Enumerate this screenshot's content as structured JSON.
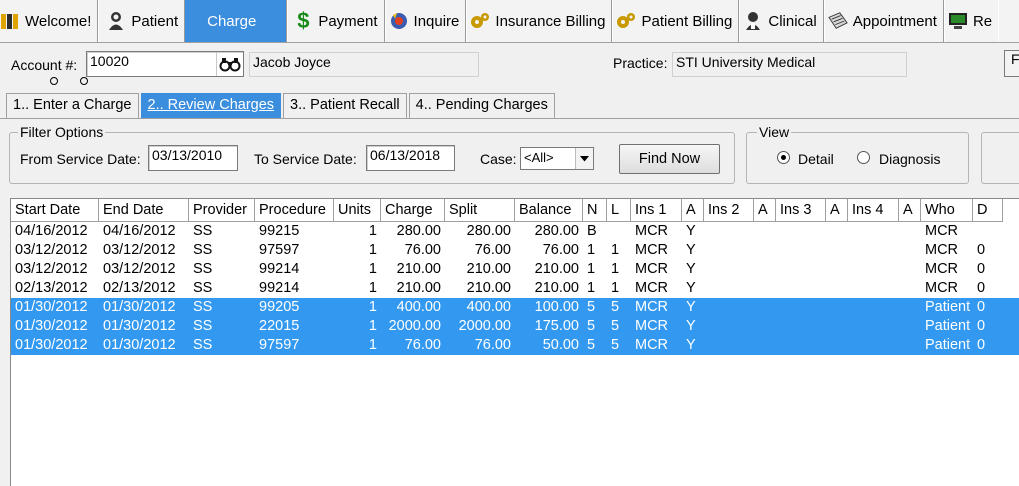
{
  "toolbar": {
    "items": [
      {
        "label": "Welcome!",
        "icon": "welcome-icon"
      },
      {
        "label": "Patient",
        "icon": "patient-icon"
      },
      {
        "label": "Charge",
        "icon": "",
        "active": true
      },
      {
        "label": "Payment",
        "icon": "dollar-icon"
      },
      {
        "label": "Inquire",
        "icon": "inquire-icon"
      },
      {
        "label": "Insurance Billing",
        "icon": "gear-icon"
      },
      {
        "label": "Patient Billing",
        "icon": "gear-icon"
      },
      {
        "label": "Clinical",
        "icon": "clinical-icon"
      },
      {
        "label": "Appointment",
        "icon": "appointment-icon"
      },
      {
        "label": "Re",
        "icon": "monitor-icon"
      }
    ]
  },
  "account": {
    "label": "Account #:",
    "value": "10020",
    "patient_name": "Jacob Joyce",
    "practice_label": "Practice:",
    "practice_value": "STI University Medical",
    "edge_button": "F"
  },
  "tabs": [
    {
      "label": "1.. Enter a Charge",
      "active": false
    },
    {
      "label": "2.. Review Charges",
      "active": true
    },
    {
      "label": "3.. Patient Recall",
      "active": false
    },
    {
      "label": "4.. Pending Charges",
      "active": false
    }
  ],
  "filter": {
    "title": "Filter Options",
    "from_label": "From Service Date:",
    "from_value": "03/13/2010",
    "to_label": "To Service Date:",
    "to_value": "06/13/2018",
    "case_label": "Case:",
    "case_value": "<All>",
    "find_button": "Find Now"
  },
  "view": {
    "title": "View",
    "detail_label": "Detail",
    "diagnosis_label": "Diagnosis",
    "selected": "Detail"
  },
  "grid": {
    "columns": [
      "Start Date",
      "End Date",
      "Provider",
      "Procedure",
      "Units",
      "Charge",
      "Split",
      "Balance",
      "N",
      "L",
      "Ins 1",
      "A",
      "Ins 2",
      "A",
      "Ins 3",
      "A",
      "Ins 4",
      "A",
      "Who",
      "D"
    ],
    "rows": [
      {
        "cells": [
          "04/16/2012",
          "04/16/2012",
          "SS",
          "99215",
          "1",
          "280.00",
          "280.00",
          "280.00",
          "B",
          "",
          "MCR",
          "Y",
          "",
          "",
          "",
          "",
          "",
          "",
          "MCR",
          ""
        ],
        "selected": false
      },
      {
        "cells": [
          "03/12/2012",
          "03/12/2012",
          "SS",
          "97597",
          "1",
          "76.00",
          "76.00",
          "76.00",
          "1",
          "1",
          "MCR",
          "Y",
          "",
          "",
          "",
          "",
          "",
          "",
          "MCR",
          "0"
        ],
        "selected": false
      },
      {
        "cells": [
          "03/12/2012",
          "03/12/2012",
          "SS",
          "99214",
          "1",
          "210.00",
          "210.00",
          "210.00",
          "1",
          "1",
          "MCR",
          "Y",
          "",
          "",
          "",
          "",
          "",
          "",
          "MCR",
          "0"
        ],
        "selected": false
      },
      {
        "cells": [
          "02/13/2012",
          "02/13/2012",
          "SS",
          "99214",
          "1",
          "210.00",
          "210.00",
          "210.00",
          "1",
          "1",
          "MCR",
          "Y",
          "",
          "",
          "",
          "",
          "",
          "",
          "MCR",
          "0"
        ],
        "selected": false
      },
      {
        "cells": [
          "01/30/2012",
          "01/30/2012",
          "SS",
          "99205",
          "1",
          "400.00",
          "400.00",
          "100.00",
          "5",
          "5",
          "MCR",
          "Y",
          "",
          "",
          "",
          "",
          "",
          "",
          "Patient",
          "0"
        ],
        "selected": true
      },
      {
        "cells": [
          "01/30/2012",
          "01/30/2012",
          "SS",
          "22015",
          "1",
          "2000.00",
          "2000.00",
          "175.00",
          "5",
          "5",
          "MCR",
          "Y",
          "",
          "",
          "",
          "",
          "",
          "",
          "Patient",
          "0"
        ],
        "selected": true
      },
      {
        "cells": [
          "01/30/2012",
          "01/30/2012",
          "SS",
          "97597",
          "1",
          "76.00",
          "76.00",
          "50.00",
          "5",
          "5",
          "MCR",
          "Y",
          "",
          "",
          "",
          "",
          "",
          "",
          "Patient",
          "0"
        ],
        "selected": true
      }
    ]
  },
  "colors": {
    "accent": "#3b8ddd",
    "selection": "#3399f0"
  }
}
